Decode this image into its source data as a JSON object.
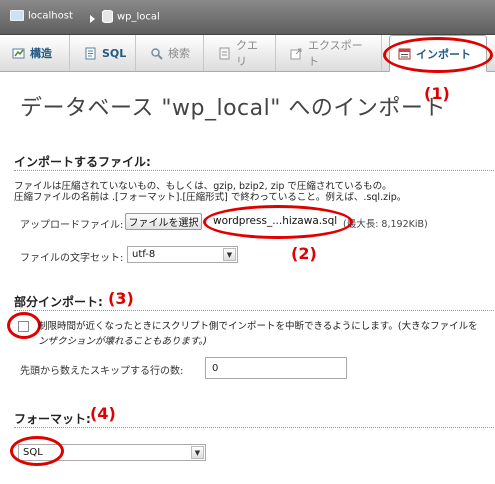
{
  "breadcrumb": {
    "server": "localhost",
    "database": "wp_local"
  },
  "tabs": [
    {
      "label": "構造",
      "icon": "structure-icon"
    },
    {
      "label": "SQL",
      "icon": "sql-icon"
    },
    {
      "label": "検索",
      "icon": "search-icon"
    },
    {
      "label": "クエリ",
      "icon": "query-icon"
    },
    {
      "label": "エクスポート",
      "icon": "export-icon"
    },
    {
      "label": "インポート",
      "icon": "import-icon",
      "active": true
    }
  ],
  "page_title": "データベース \"wp_local\" へのインポート",
  "file_section": {
    "heading": "インポートするファイル:",
    "help_line1": "ファイルは圧縮されていないもの、もしくは、gzip, bzip2, zip で圧縮されているもの。",
    "help_line2": "圧縮ファイルの名前は .[フォーマット].[圧縮形式] で終わっていること。例えば、.sql.zip。",
    "upload_label": "アップロードファイル:",
    "choose_button": "ファイルを選択",
    "chosen_file": "wordpress_...hizawa.sql",
    "max_size": "(最大長: 8,192KiB)",
    "charset_label": "ファイルの文字セット:",
    "charset_value": "utf-8"
  },
  "partial_section": {
    "heading": "部分インポート:",
    "checkbox_line1": "制限時間が近くなったときにスクリプト側でインポートを中断できるようにします。(大きなファイルを",
    "checkbox_line2": "ンザクションが壊れることもあります。)",
    "skip_label": "先頭から数えたスキップする行の数:",
    "skip_value": "0"
  },
  "format_section": {
    "heading": "フォーマット:",
    "value": "SQL"
  },
  "annotations": {
    "n1": "(1)",
    "n2": "(2)",
    "n3": "(3)",
    "n4": "(4)",
    "color": "#e00000"
  }
}
